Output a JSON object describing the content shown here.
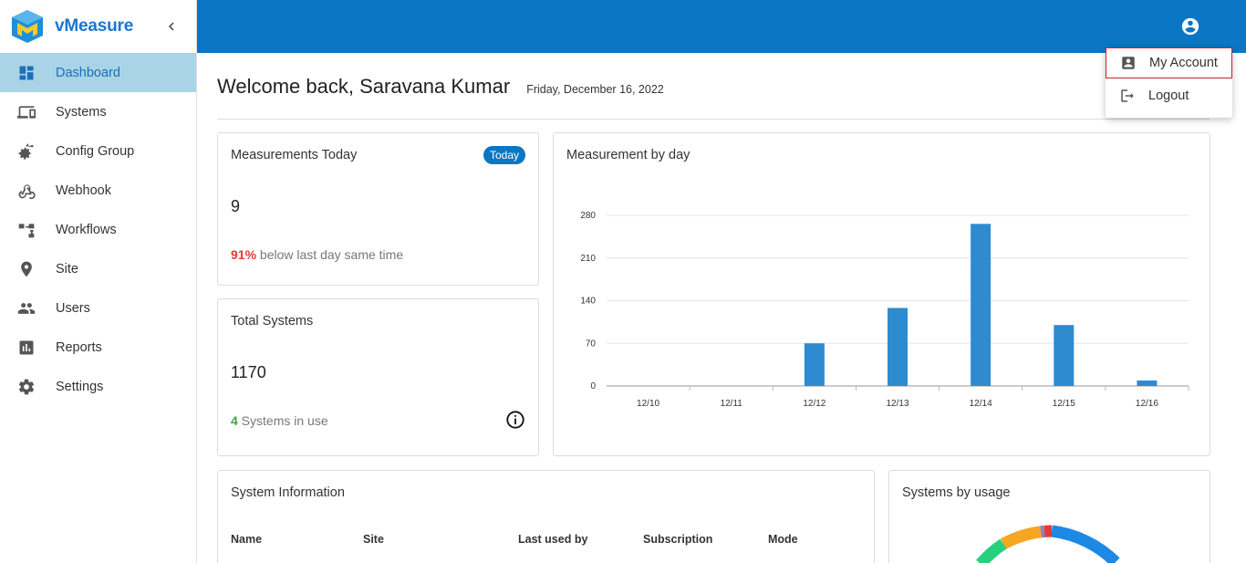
{
  "brand": {
    "name": "vMeasure"
  },
  "sidebar": {
    "items": [
      {
        "label": "Dashboard",
        "icon": "dashboard-icon",
        "active": true
      },
      {
        "label": "Systems",
        "icon": "devices-icon"
      },
      {
        "label": "Config Group",
        "icon": "config-gears-icon"
      },
      {
        "label": "Webhook",
        "icon": "webhook-icon"
      },
      {
        "label": "Workflows",
        "icon": "workflow-icon"
      },
      {
        "label": "Site",
        "icon": "location-pin-icon"
      },
      {
        "label": "Users",
        "icon": "users-icon"
      },
      {
        "label": "Reports",
        "icon": "reports-icon"
      },
      {
        "label": "Settings",
        "icon": "gear-icon"
      }
    ]
  },
  "header": {
    "welcome": "Welcome back, Saravana Kumar",
    "date": "Friday, December 16, 2022"
  },
  "account_menu": {
    "items": [
      {
        "label": "My Account",
        "icon": "account-box-icon"
      },
      {
        "label": "Logout",
        "icon": "logout-icon"
      }
    ]
  },
  "measurements_today": {
    "title": "Measurements Today",
    "badge": "Today",
    "value": "9",
    "change_pct": "91%",
    "change_text": " below last day same time"
  },
  "total_systems": {
    "title": "Total Systems",
    "value": "1170",
    "in_use_count": "4",
    "in_use_text": " Systems in use"
  },
  "measurement_by_day": {
    "title": "Measurement by day"
  },
  "system_information": {
    "title": "System Information",
    "columns": [
      "Name",
      "Site",
      "Last used by",
      "Subscription",
      "Mode"
    ]
  },
  "systems_by_usage": {
    "title": "Systems by usage"
  },
  "colors": {
    "topbar": "#0a76c4",
    "bar": "#2e8bd0",
    "active_nav_bg": "#a9d4e8"
  },
  "chart_data": {
    "type": "bar",
    "categories": [
      "12/10",
      "12/11",
      "12/12",
      "12/13",
      "12/14",
      "12/15",
      "12/16"
    ],
    "values": [
      0,
      0,
      70,
      128,
      266,
      100,
      9
    ],
    "yticks": [
      0,
      70,
      140,
      210,
      280
    ],
    "ylim": [
      0,
      280
    ],
    "grid": true
  }
}
